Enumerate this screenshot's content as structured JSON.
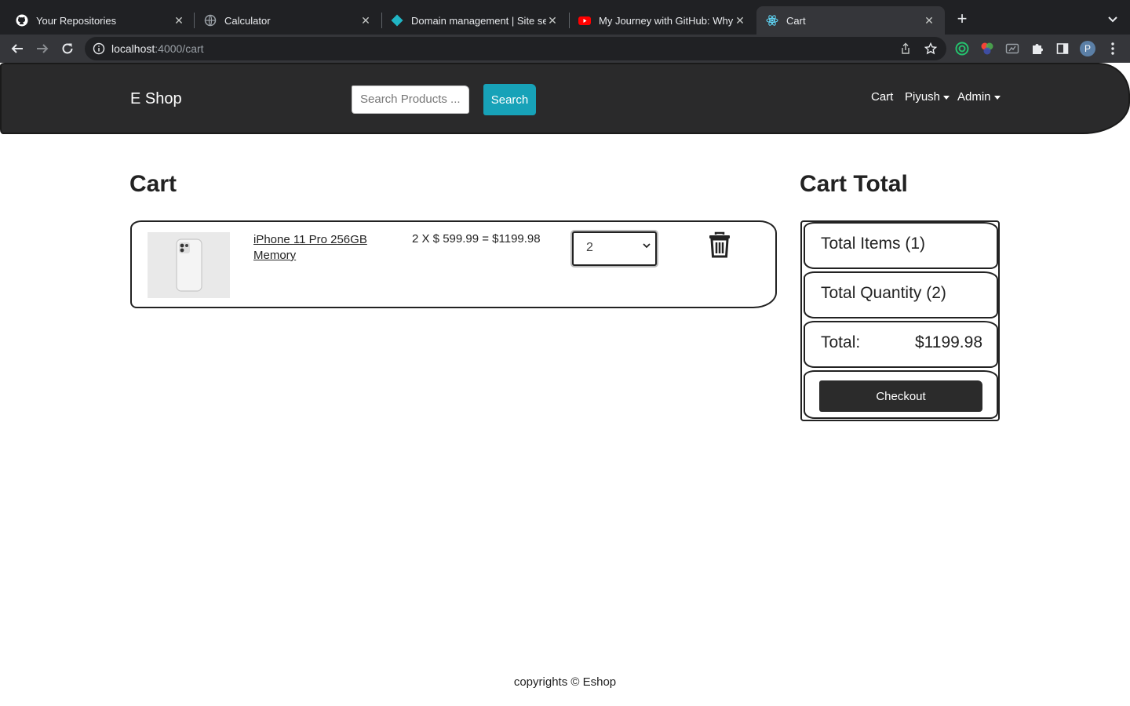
{
  "browser": {
    "tabs": [
      {
        "title": "Your Repositories",
        "icon": "github-icon"
      },
      {
        "title": "Calculator",
        "icon": "globe-icon"
      },
      {
        "title": "Domain management | Site set",
        "icon": "netlify-icon"
      },
      {
        "title": "My Journey with GitHub: Why c",
        "icon": "youtube-icon"
      },
      {
        "title": "Cart",
        "icon": "react-icon",
        "active": true
      }
    ],
    "url_host": "localhost",
    "url_path": ":4000/cart",
    "profile_initial": "P"
  },
  "navbar": {
    "brand": "E Shop",
    "search_placeholder": "Search Products ...",
    "search_button": "Search",
    "cart_link": "Cart",
    "user_menu": "Piyush",
    "admin_menu": "Admin"
  },
  "cart": {
    "title": "Cart",
    "items": [
      {
        "name": "iPhone 11 Pro 256GB Memory",
        "price_line": "2 X $ 599.99 = $1199.98",
        "quantity": "2"
      }
    ]
  },
  "summary": {
    "title": "Cart Total",
    "total_items": "Total Items (1)",
    "total_quantity": "Total Quantity (2)",
    "total_label": "Total:",
    "total_amount": "$1199.98",
    "checkout_button": "Checkout"
  },
  "footer": {
    "text": "copyrights © Eshop"
  },
  "colors": {
    "navbar_bg": "#2a2a2b",
    "search_button": "#17a2b8",
    "checkout_button": "#2b2b2b"
  }
}
